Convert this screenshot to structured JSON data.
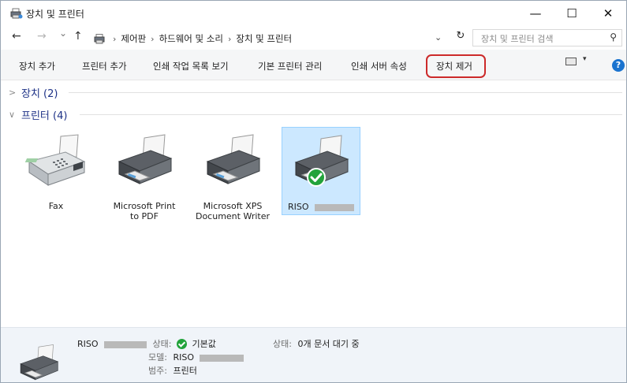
{
  "window": {
    "title": "장치 및 프린터",
    "minimize": "—",
    "maximize": "☐",
    "close": "✕"
  },
  "nav": {
    "back": "←",
    "forward": "→",
    "recent": "⌄",
    "up": "↑",
    "breadcrumb": [
      "제어판",
      "하드웨어 및 소리",
      "장치 및 프린터"
    ],
    "dropdown": "⌄",
    "refresh": "↻",
    "search_placeholder": "장치 및 프린터 검색"
  },
  "commands": [
    "장치 추가",
    "프린터 추가",
    "인쇄 작업 목록 보기",
    "기본 프린터 관리",
    "인쇄 서버 속성",
    "장치 제거"
  ],
  "toolbar_right": {
    "view_caret": "▾",
    "help": "?"
  },
  "groups": {
    "devices": {
      "chevron": ">",
      "label": "장치 (2)"
    },
    "printers": {
      "chevron": "∨",
      "label": "프린터 (4)"
    }
  },
  "printers": [
    {
      "label": "Fax"
    },
    {
      "label_line1": "Microsoft Print",
      "label_line2": "to PDF"
    },
    {
      "label_line1": "Microsoft XPS",
      "label_line2": "Document Writer"
    },
    {
      "label": "RISO",
      "selected": true,
      "default": true
    }
  ],
  "details": {
    "name": "RISO",
    "status_key": "상태:",
    "status_value": "기본값",
    "model_key": "모델:",
    "model_value": "RISO",
    "category_key": "범주:",
    "category_value": "프린터",
    "queue_key": "상태:",
    "queue_value": "0개 문서 대기 중"
  },
  "colors": {
    "selection_bg": "#cce8ff",
    "selection_border": "#99d1ff",
    "highlight": "#cc2a2a",
    "group_text": "#1e3287",
    "default_badge": "#22a33b",
    "help": "#1a73cf"
  }
}
